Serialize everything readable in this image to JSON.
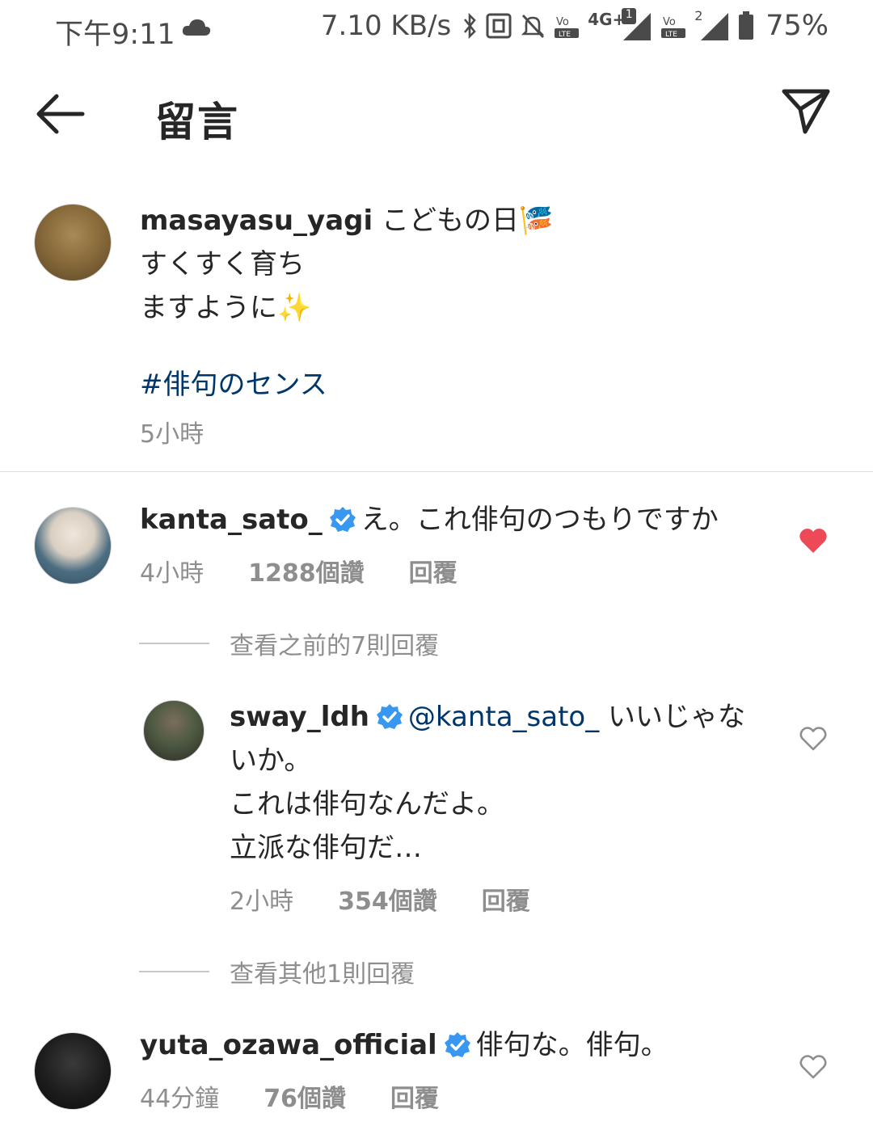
{
  "status_bar": {
    "time": "下午9:11",
    "net_speed": "7.10 KB/s",
    "battery": "75%",
    "icons": [
      "cloud-icon",
      "bluetooth-icon",
      "nfc-icon",
      "mute-icon",
      "volte-icon",
      "signal-icon",
      "battery-icon"
    ],
    "sim1_tag": "4G+",
    "sim1_badge": "1",
    "sim2_badge": "2",
    "volte_label": "LTE"
  },
  "header": {
    "title": "留言",
    "back_icon": "arrow-left-icon",
    "send_icon": "paper-plane-icon"
  },
  "caption": {
    "username": "masayasu_yagi",
    "line1": "こどもの日🎏",
    "line2": "すくすく育ち",
    "line3": "ますように✨",
    "hashtag": "#俳句のセンス",
    "time": "5小時"
  },
  "comments": [
    {
      "username": "kanta_sato_",
      "verified": true,
      "text": "え。これ俳句のつもりですか",
      "time": "4小時",
      "likes": "1288個讚",
      "reply": "回覆",
      "liked": true,
      "view_replies": "查看之前的7則回覆"
    },
    {
      "username": "sway_ldh",
      "verified": true,
      "mention": "@kanta_sato_",
      "text1": "いいじゃな",
      "text2": "いか。",
      "text3": "これは俳句なんだよ。",
      "text4": "立派な俳句だ…",
      "time": "2小時",
      "likes": "354個讚",
      "reply": "回覆",
      "liked": false,
      "view_replies": "查看其他1則回覆"
    },
    {
      "username": "yuta_ozawa_official",
      "verified": true,
      "text": "俳句な。俳句。",
      "time": "44分鐘",
      "likes": "76個讚",
      "reply": "回覆",
      "liked": false
    }
  ],
  "colors": {
    "text": "#262626",
    "secondary": "#8e8e8e",
    "link": "#00376b",
    "verified": "#3897f0",
    "like_red": "#ed4956"
  }
}
